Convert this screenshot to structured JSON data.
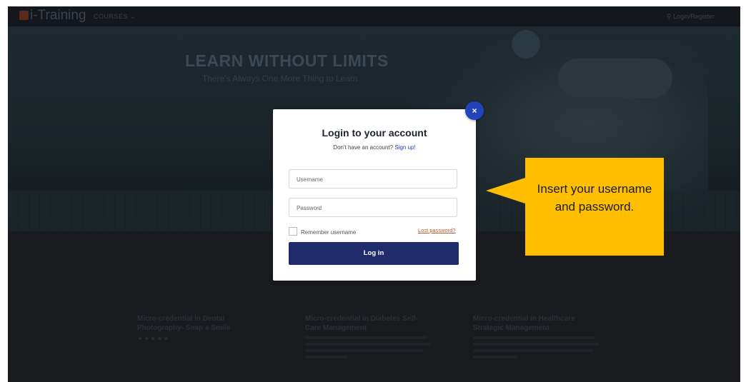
{
  "nav": {
    "logo": "i-Training",
    "courses_menu": "COURSES",
    "login_register": "Login/Register"
  },
  "hero": {
    "title": "LEARN WITHOUT LIMITS",
    "subtitle": "There's Always One More Thing to Learn"
  },
  "courses": [
    {
      "title": "Micro-credential in Dental Photography- Snap a Smile",
      "stars": "★★★★★"
    },
    {
      "title": "Micro-credential in Diabetes Self-Care Management",
      "stars": ""
    },
    {
      "title": "Micro-credential in Healthcare Strategic Management",
      "stars": ""
    }
  ],
  "modal": {
    "close_symbol": "×",
    "title": "Login to your account",
    "signup_prompt": "Don't have an account?",
    "signup_link": "Sign up!",
    "username_placeholder": "Username",
    "password_placeholder": "Password",
    "remember_label": "Remember username",
    "lost_password": "Lost password?",
    "login_button": "Log in"
  },
  "callout": {
    "text": "Insert your username and password.",
    "color": "#ffbf00"
  },
  "colors": {
    "primary_button": "#1f2b6a",
    "close_button": "#2244bb",
    "link": "#2244bb",
    "lost_password_link": "#c15a2e"
  }
}
